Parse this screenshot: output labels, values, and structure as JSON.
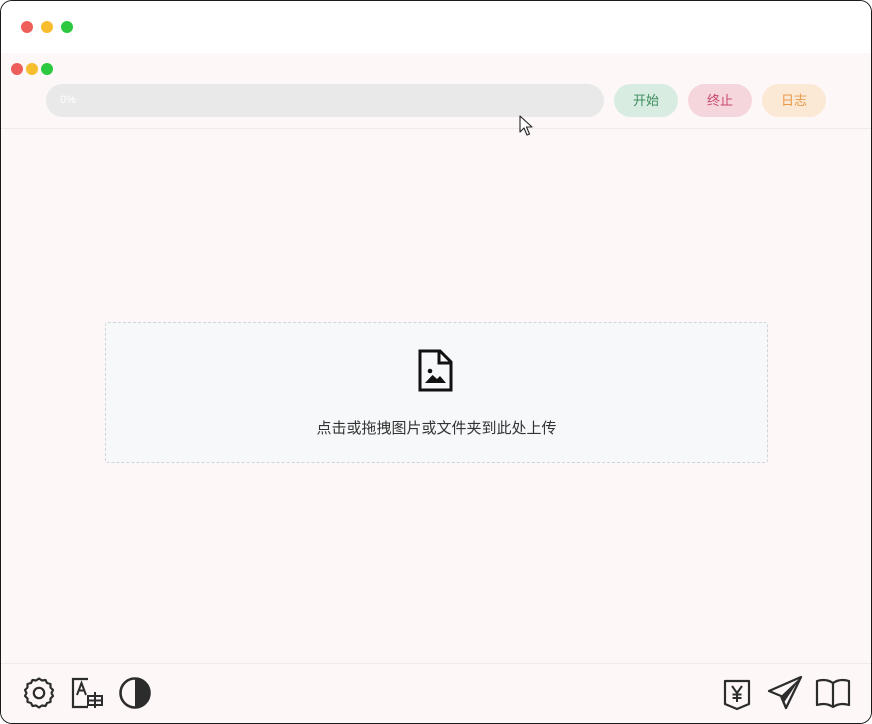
{
  "toolbar": {
    "progress": {
      "value": 0,
      "label": "0%"
    },
    "start_label": "开始",
    "stop_label": "终止",
    "log_label": "日志"
  },
  "dropzone": {
    "icon": "image-file-icon",
    "text": "点击或拖拽图片或文件夹到此处上传"
  },
  "bottom_left_icons": [
    "gear-icon",
    "translate-icon",
    "contrast-icon"
  ],
  "bottom_right_icons": [
    "yen-icon",
    "send-icon",
    "book-icon"
  ],
  "colors": {
    "background": "#fdf8f7",
    "start": "#3a8d5e",
    "stop": "#c7486a",
    "log": "#e59a4a"
  }
}
